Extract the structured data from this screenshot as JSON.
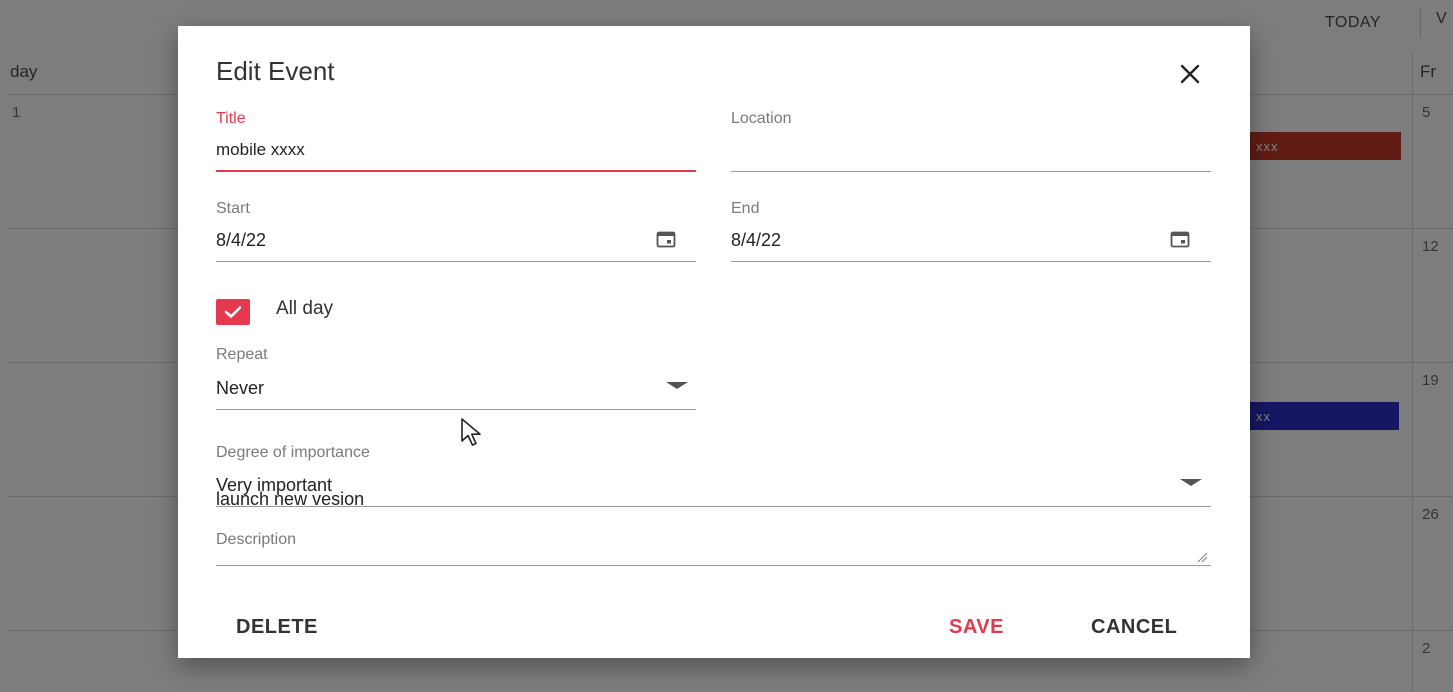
{
  "calendar": {
    "today_label": "TODAY",
    "view_cut_label": "V",
    "day_header_left": "day",
    "day_header_right": "Fr",
    "dates_left": [
      "1"
    ],
    "dates_right": [
      "5",
      "12",
      "19",
      "26",
      "2"
    ],
    "events": [
      {
        "label": "xxx",
        "color": "#c0392b"
      },
      {
        "label": "xx",
        "color": "#2c2cc4"
      }
    ]
  },
  "dialog": {
    "title": "Edit Event",
    "close_icon": "close-icon",
    "title_field": {
      "label": "Title",
      "value": "mobile xxxx"
    },
    "location_field": {
      "label": "Location",
      "value": ""
    },
    "start_field": {
      "label": "Start",
      "value": "8/4/22",
      "icon": "calendar-icon"
    },
    "end_field": {
      "label": "End",
      "value": "8/4/22",
      "icon": "calendar-icon"
    },
    "all_day": {
      "label": "All day",
      "checked": true
    },
    "repeat_field": {
      "label": "Repeat",
      "value": "Never"
    },
    "importance_field": {
      "label": "Degree of importance",
      "value": "Very important",
      "overflow_text": "launch new vesion"
    },
    "description_field": {
      "label": "Description",
      "value": ""
    },
    "buttons": {
      "delete": "DELETE",
      "save": "SAVE",
      "cancel": "CANCEL"
    }
  },
  "colors": {
    "accent": "#e5394f",
    "overlay": "rgba(0,0,0,0.5)"
  }
}
